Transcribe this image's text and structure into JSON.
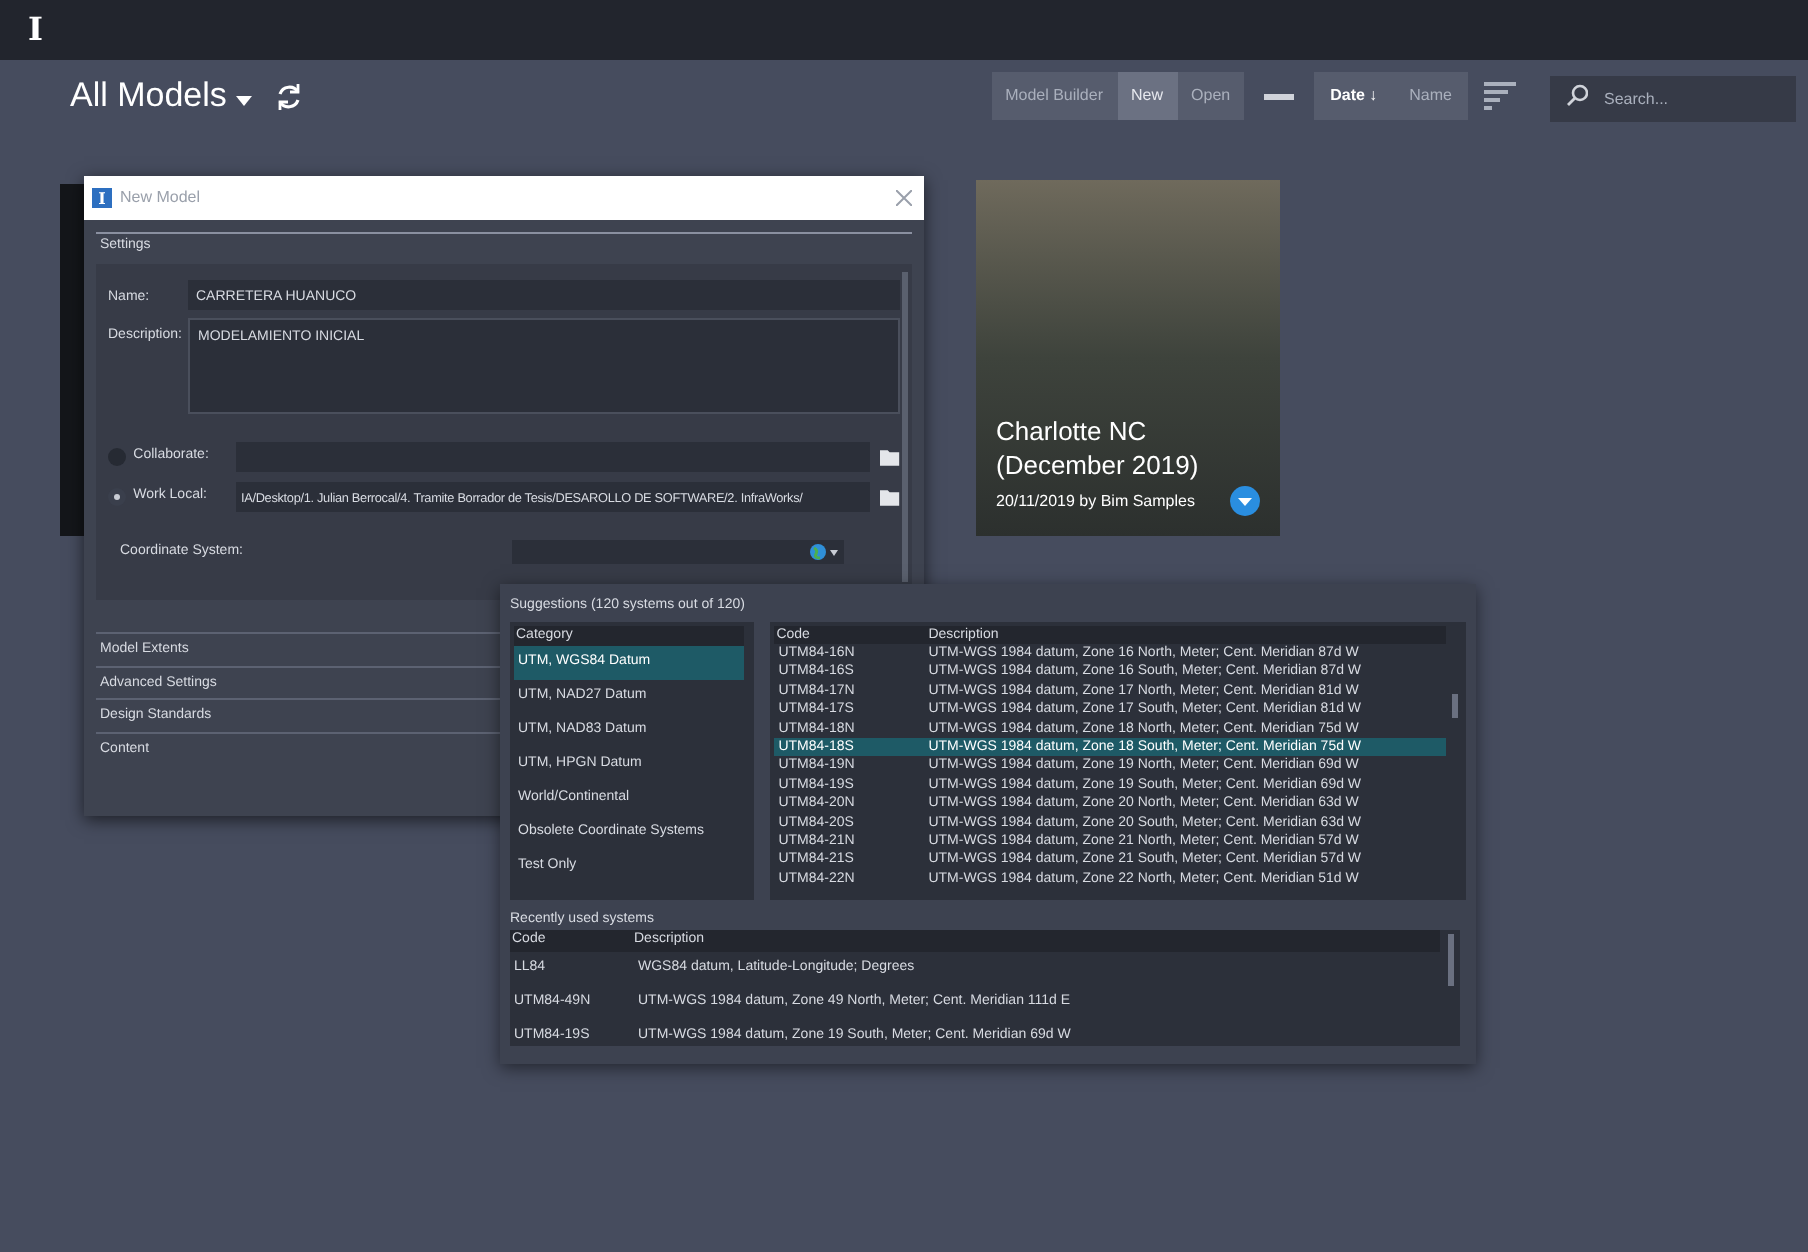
{
  "app_bar": {
    "logo": "I"
  },
  "header": {
    "title": "All Models"
  },
  "toolbar": {
    "actions": [
      {
        "label": "Model Builder",
        "selected": false
      },
      {
        "label": "New",
        "selected": true
      },
      {
        "label": "Open",
        "selected": false
      }
    ],
    "sort": [
      {
        "label": "Date ↓",
        "selected": true
      },
      {
        "label": "Name",
        "selected": false
      }
    ],
    "search": {
      "placeholder": "Search..."
    }
  },
  "models": [
    {
      "title": "Charlotte NC (December 2019)",
      "subtitle": "20/11/2019 by Bim Samples"
    }
  ],
  "dialog": {
    "logo": "I",
    "title": "New Model",
    "tab": "Settings",
    "name": {
      "label": "Name:",
      "value": "CARRETERA HUANUCO"
    },
    "description": {
      "label": "Description:",
      "value": "MODELAMIENTO INICIAL"
    },
    "storage": [
      {
        "label": "Collaborate:",
        "selected": false
      },
      {
        "label": "Work Local:",
        "value": "IA/Desktop/1. Julian Berrocal/4. Tramite Borrador de Tesis/DESAROLLO DE SOFTWARE/2. InfraWorks/",
        "selected": true
      }
    ],
    "coordinate_system": {
      "label": "Coordinate System:"
    },
    "sections": [
      "Model Extents",
      "Advanced Settings",
      "Design Standards",
      "Content"
    ]
  },
  "coordinate_popup": {
    "suggestions_label": "Suggestions (120 systems out of 120)",
    "category_header": "Category",
    "categories": [
      {
        "label": "UTM, WGS84 Datum",
        "selected": true
      },
      {
        "label": "UTM, NAD27 Datum",
        "selected": false
      },
      {
        "label": "UTM, NAD83 Datum",
        "selected": false
      },
      {
        "label": "UTM, HPGN Datum",
        "selected": false
      },
      {
        "label": "World/Continental",
        "selected": false
      },
      {
        "label": "Obsolete Coordinate Systems",
        "selected": false
      },
      {
        "label": "Test Only",
        "selected": false
      }
    ],
    "columns": [
      "Code",
      "Description"
    ],
    "rows": [
      {
        "code": "UTM84-16N",
        "description": "UTM-WGS 1984 datum, Zone 16 North, Meter; Cent. Meridian 87d W",
        "selected": false
      },
      {
        "code": "UTM84-16S",
        "description": "UTM-WGS 1984 datum, Zone 16 South, Meter; Cent. Meridian 87d W",
        "selected": false
      },
      {
        "code": "UTM84-17N",
        "description": "UTM-WGS 1984 datum, Zone 17 North, Meter; Cent. Meridian 81d W",
        "selected": false
      },
      {
        "code": "UTM84-17S",
        "description": "UTM-WGS 1984 datum, Zone 17 South, Meter; Cent. Meridian 81d W",
        "selected": false
      },
      {
        "code": "UTM84-18N",
        "description": "UTM-WGS 1984 datum, Zone 18 North, Meter; Cent. Meridian 75d W",
        "selected": false
      },
      {
        "code": "UTM84-18S",
        "description": "UTM-WGS 1984 datum, Zone 18 South, Meter; Cent. Meridian 75d W",
        "selected": true
      },
      {
        "code": "UTM84-19N",
        "description": "UTM-WGS 1984 datum, Zone 19 North, Meter; Cent. Meridian 69d W",
        "selected": false
      },
      {
        "code": "UTM84-19S",
        "description": "UTM-WGS 1984 datum, Zone 19 South, Meter; Cent. Meridian 69d W",
        "selected": false
      },
      {
        "code": "UTM84-20N",
        "description": "UTM-WGS 1984 datum, Zone 20 North, Meter; Cent. Meridian 63d W",
        "selected": false
      },
      {
        "code": "UTM84-20S",
        "description": "UTM-WGS 1984 datum, Zone 20 South, Meter; Cent. Meridian 63d W",
        "selected": false
      },
      {
        "code": "UTM84-21N",
        "description": "UTM-WGS 1984 datum, Zone 21 North, Meter; Cent. Meridian 57d W",
        "selected": false
      },
      {
        "code": "UTM84-21S",
        "description": "UTM-WGS 1984 datum, Zone 21 South, Meter; Cent. Meridian 57d W",
        "selected": false
      },
      {
        "code": "UTM84-22N",
        "description": "UTM-WGS 1984 datum, Zone 22 North, Meter; Cent. Meridian 51d W",
        "selected": false
      }
    ],
    "recent_label": "Recently used systems",
    "recent_columns": [
      "Code",
      "Description"
    ],
    "recent_rows": [
      {
        "code": "LL84",
        "description": "WGS84 datum, Latitude-Longitude; Degrees"
      },
      {
        "code": "UTM84-49N",
        "description": "UTM-WGS 1984 datum, Zone 49 North, Meter; Cent. Meridian 111d E"
      },
      {
        "code": "UTM84-19S",
        "description": "UTM-WGS 1984 datum, Zone 19 South, Meter; Cent. Meridian 69d W"
      }
    ]
  }
}
